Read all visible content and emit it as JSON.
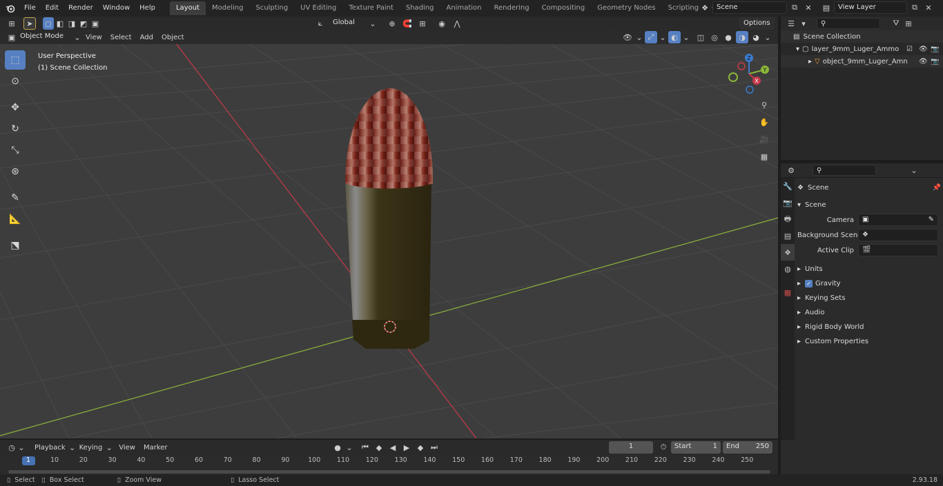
{
  "topbar": {
    "menus": [
      "File",
      "Edit",
      "Render",
      "Window",
      "Help"
    ],
    "workspaces": [
      "Layout",
      "Modeling",
      "Sculpting",
      "UV Editing",
      "Texture Paint",
      "Shading",
      "Animation",
      "Rendering",
      "Compositing",
      "Geometry Nodes",
      "Scripting"
    ],
    "active_workspace": "Layout",
    "add_tab": "+",
    "scene_name": "Scene",
    "view_layer_name": "View Layer"
  },
  "viewport_header": {
    "mode": "Object Mode",
    "menus": [
      "View",
      "Select",
      "Add",
      "Object"
    ],
    "orientation": "Global",
    "options_label": "Options"
  },
  "viewport": {
    "perspective_label": "User Perspective",
    "collection_label": "(1) Scene Collection",
    "gizmo_axes": [
      "Z",
      "Y",
      "X"
    ],
    "axis_colors": {
      "x": "#c73a4a",
      "y": "#8cb63a",
      "z": "#3a7bd0",
      "grid_bg": "#3d3d3d"
    }
  },
  "outliner": {
    "root": "Scene Collection",
    "layer_item": "layer_9mm_Luger_Ammo",
    "object_item": "object_9mm_Luger_Amn"
  },
  "properties": {
    "context": "Scene",
    "section": "Scene",
    "fields": [
      {
        "label": "Camera"
      },
      {
        "label": "Background Scene"
      },
      {
        "label": "Active Clip"
      }
    ],
    "panels": [
      "Units",
      "Gravity",
      "Keying Sets",
      "Audio",
      "Rigid Body World",
      "Custom Properties"
    ],
    "gravity_checked": true
  },
  "timeline": {
    "menus": [
      "Playback",
      "Keying",
      "View",
      "Marker"
    ],
    "current_frame": "1",
    "start_label": "Start",
    "start_value": "1",
    "end_label": "End",
    "end_value": "250",
    "ticks": [
      "1",
      "10",
      "20",
      "30",
      "40",
      "50",
      "60",
      "70",
      "80",
      "90",
      "100",
      "110",
      "120",
      "130",
      "140",
      "150",
      "160",
      "170",
      "180",
      "190",
      "200",
      "210",
      "220",
      "230",
      "240",
      "250"
    ]
  },
  "statusbar": {
    "select": "Select",
    "box_select": "Box Select",
    "zoom_view": "Zoom View",
    "lasso_select": "Lasso Select",
    "version": "2.93.18"
  }
}
